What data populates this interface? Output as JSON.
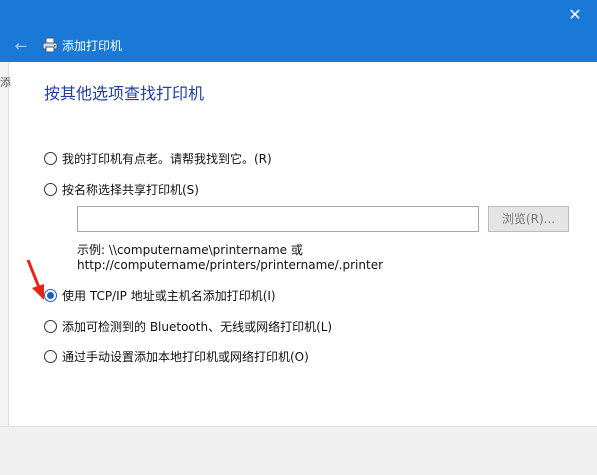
{
  "window": {
    "close_glyph": "✕",
    "title": "添加打印机",
    "back_glyph": "←",
    "icons": {
      "back": "back-arrow-icon",
      "printer": "printer-icon",
      "close": "close-icon"
    }
  },
  "background_window": {
    "sliver_text": "添"
  },
  "page": {
    "heading": "按其他选项查找打印机"
  },
  "options": [
    {
      "label": "我的打印机有点老。请帮我找到它。(R)",
      "checked": false
    },
    {
      "label": "按名称选择共享打印机(S)",
      "checked": false
    },
    {
      "label": "使用 TCP/IP 地址或主机名添加打印机(I)",
      "checked": true
    },
    {
      "label": "添加可检测到的 Bluetooth、无线或网络打印机(L)",
      "checked": false
    },
    {
      "label": "通过手动设置添加本地打印机或网络打印机(O)",
      "checked": false
    }
  ],
  "share": {
    "input_value": "",
    "browse_label": "浏览(R)...",
    "example_line1": "示例: \\\\computername\\printername 或",
    "example_line2": "http://computername/printers/printername/.printer"
  },
  "colors": {
    "accent": "#1a78d7",
    "heading": "#1f3f9f",
    "annotation_arrow": "#e8241a"
  }
}
